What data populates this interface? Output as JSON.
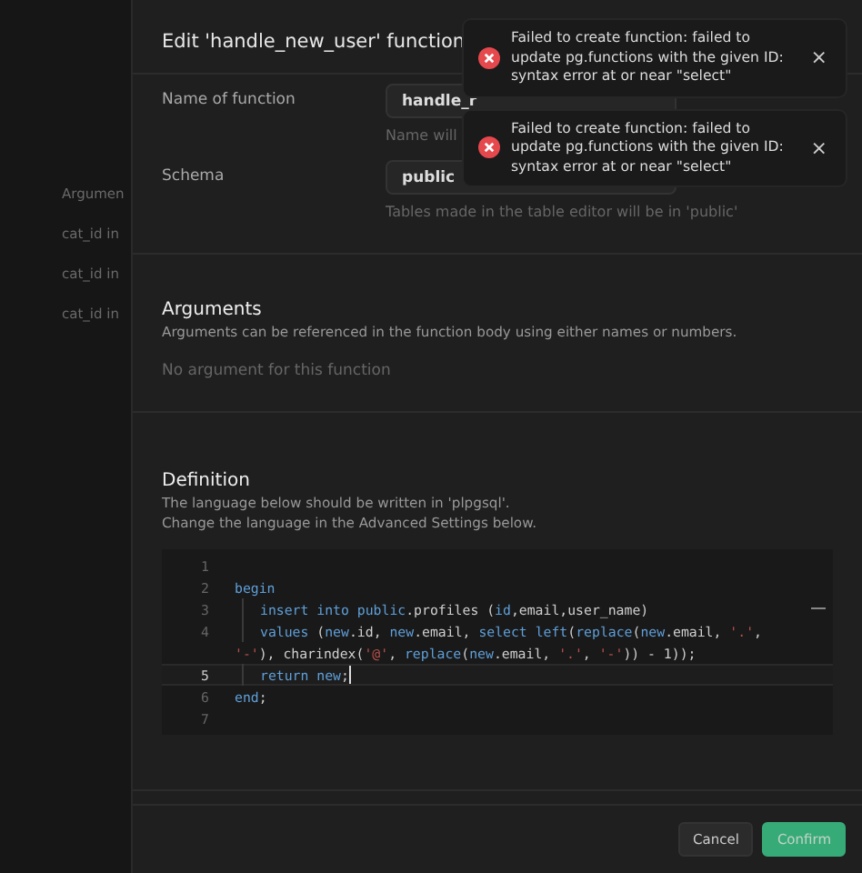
{
  "background_items": [
    "Argumen",
    "cat_id in",
    "cat_id in",
    "cat_id in"
  ],
  "dialog": {
    "title": "Edit 'handle_new_user' function",
    "fields": [
      {
        "label": "Name of function",
        "value": "handle_r",
        "hint": "Name will"
      },
      {
        "label": "Schema",
        "value": "public",
        "hint": "Tables made in the table editor will be in 'public'"
      }
    ],
    "arguments": {
      "heading": "Arguments",
      "description": "Arguments can be referenced in the function body using either names or numbers.",
      "empty": "No argument for this function"
    },
    "definition": {
      "heading": "Definition",
      "notes": [
        "The language below should be written in 'plpgsql'.",
        "Change the language in the Advanced Settings below."
      ],
      "lines": [
        {
          "number": "1",
          "current": false,
          "rows": [
            {
              "guide": false,
              "tokens": []
            }
          ]
        },
        {
          "number": "2",
          "current": false,
          "rows": [
            {
              "guide": false,
              "tokens": [
                {
                  "kind": "kw",
                  "text": "begin"
                }
              ]
            }
          ]
        },
        {
          "number": "3",
          "current": false,
          "rows": [
            {
              "guide": true,
              "tokens": [
                {
                  "kind": "kw",
                  "text": "insert into public"
                },
                {
                  "kind": "plain",
                  "text": ".profiles ("
                },
                {
                  "kind": "kw",
                  "text": "id"
                },
                {
                  "kind": "plain",
                  "text": ",email,user_name)"
                }
              ]
            }
          ]
        },
        {
          "number": "4",
          "current": false,
          "rows": [
            {
              "guide": true,
              "tokens": [
                {
                  "kind": "kw",
                  "text": "values"
                },
                {
                  "kind": "plain",
                  "text": " ("
                },
                {
                  "kind": "kw",
                  "text": "new"
                },
                {
                  "kind": "plain",
                  "text": ".id, "
                },
                {
                  "kind": "kw",
                  "text": "new"
                },
                {
                  "kind": "plain",
                  "text": ".email, "
                },
                {
                  "kind": "kw",
                  "text": "select left"
                },
                {
                  "kind": "plain",
                  "text": "("
                },
                {
                  "kind": "kw",
                  "text": "replace"
                },
                {
                  "kind": "plain",
                  "text": "("
                },
                {
                  "kind": "kw",
                  "text": "new"
                },
                {
                  "kind": "plain",
                  "text": ".email, "
                },
                {
                  "kind": "str",
                  "text": "'.'"
                },
                {
                  "kind": "plain",
                  "text": ","
                }
              ]
            },
            {
              "guide": false,
              "tokens": [
                {
                  "kind": "str",
                  "text": "'-'"
                },
                {
                  "kind": "plain",
                  "text": "), charindex("
                },
                {
                  "kind": "str",
                  "text": "'@'"
                },
                {
                  "kind": "plain",
                  "text": ", "
                },
                {
                  "kind": "kw",
                  "text": "replace"
                },
                {
                  "kind": "plain",
                  "text": "("
                },
                {
                  "kind": "kw",
                  "text": "new"
                },
                {
                  "kind": "plain",
                  "text": ".email, "
                },
                {
                  "kind": "str",
                  "text": "'.'"
                },
                {
                  "kind": "plain",
                  "text": ", "
                },
                {
                  "kind": "str",
                  "text": "'-'"
                },
                {
                  "kind": "plain",
                  "text": ")) - 1));"
                }
              ]
            }
          ]
        },
        {
          "number": "5",
          "current": true,
          "rows": [
            {
              "guide": true,
              "tokens": [
                {
                  "kind": "kw",
                  "text": "return new"
                },
                {
                  "kind": "plain",
                  "text": ";"
                }
              ]
            }
          ]
        },
        {
          "number": "6",
          "current": false,
          "rows": [
            {
              "guide": false,
              "tokens": [
                {
                  "kind": "kw",
                  "text": "end"
                },
                {
                  "kind": "plain",
                  "text": ";"
                }
              ]
            }
          ]
        },
        {
          "number": "7",
          "current": false,
          "rows": [
            {
              "guide": false,
              "tokens": []
            }
          ]
        }
      ]
    },
    "buttons": [
      {
        "label": "Cancel",
        "kind": "secondary"
      },
      {
        "label": "Confirm",
        "kind": "primary"
      }
    ]
  },
  "toasts": [
    {
      "message": "Failed to create function: failed to update pg.functions with the given ID: syntax error at or near \"select\"",
      "close": "×"
    },
    {
      "message": "Failed to create function: failed to update pg.functions with the given ID: syntax error at or near \"select\"",
      "close": "×"
    }
  ]
}
